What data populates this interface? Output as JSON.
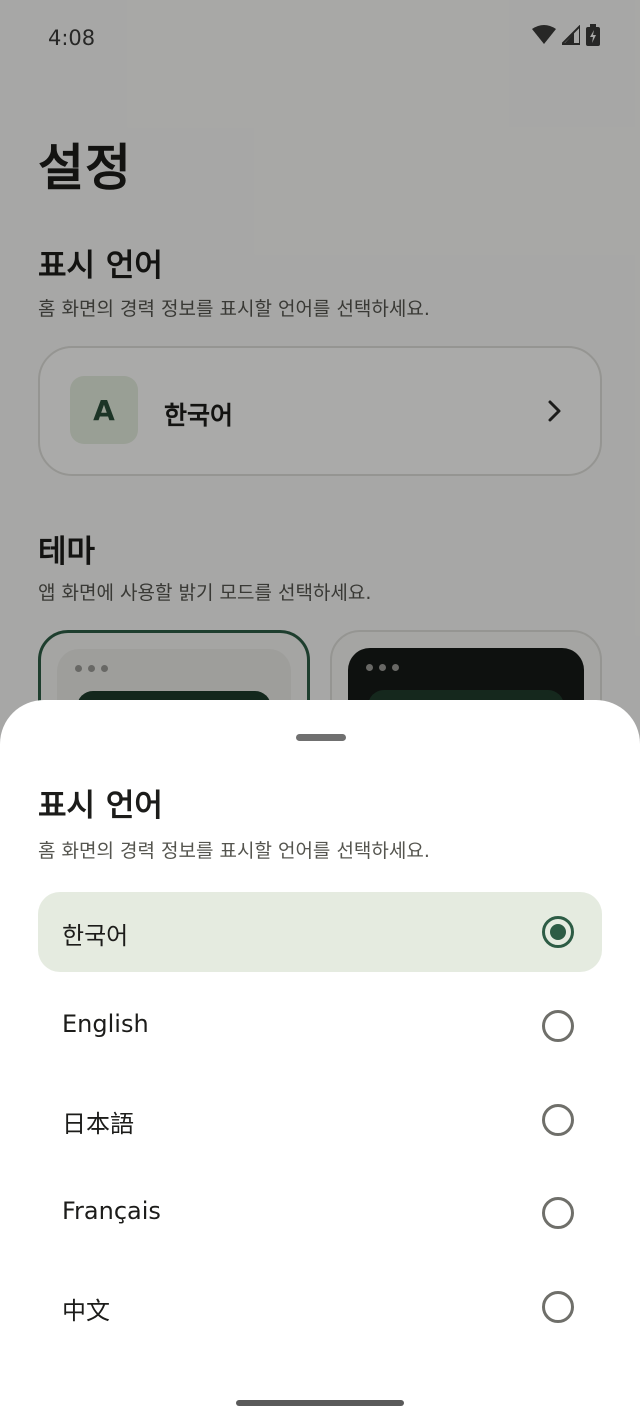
{
  "status_bar": {
    "time": "4:08",
    "icons": [
      "wifi-icon",
      "cellular-signal-icon",
      "battery-charging-icon"
    ]
  },
  "settings": {
    "title": "설정",
    "language_section": {
      "title": "표시 언어",
      "description": "홈 화면의 경력 정보를 표시할 언어를 선택하세요.",
      "current_avatar": "A",
      "current_language": "한국어"
    },
    "theme_section": {
      "title": "테마",
      "description": "앱 화면에 사용할 밝기 모드를 선택하세요.",
      "options": [
        {
          "mode": "light",
          "selected": true
        },
        {
          "mode": "dark",
          "selected": false
        }
      ]
    }
  },
  "language_sheet": {
    "title": "표시 언어",
    "description": "홈 화면의 경력 정보를 표시할 언어를 선택하세요.",
    "options": [
      {
        "label": "한국어",
        "selected": true
      },
      {
        "label": "English",
        "selected": false
      },
      {
        "label": "日本語",
        "selected": false
      },
      {
        "label": "Français",
        "selected": false
      },
      {
        "label": "中文",
        "selected": false
      }
    ]
  },
  "colors": {
    "accent": "#2d5c45",
    "selected_row": "#e5ebe0",
    "scrim": "rgba(0,0,0,0.32)"
  }
}
